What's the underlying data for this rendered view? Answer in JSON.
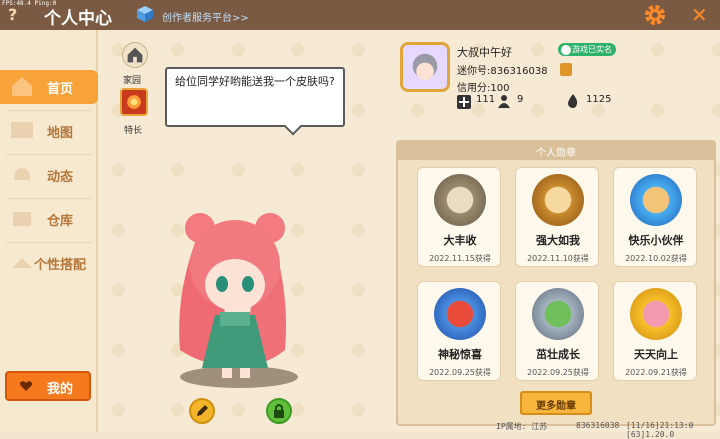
{
  "debug": {
    "fps_text": "FPS:48.4  Ping:0"
  },
  "header": {
    "title": "个人中心",
    "help_icon": "question-icon",
    "platform_link": "创作者服务平台>>",
    "accent": "#ff8a2a"
  },
  "sidebar": {
    "items": [
      {
        "label": "首页",
        "icon": "home-icon",
        "active": true
      },
      {
        "label": "地图",
        "icon": "map-icon",
        "active": false
      },
      {
        "label": "动态",
        "icon": "bell-icon",
        "active": false
      },
      {
        "label": "仓库",
        "icon": "box-icon",
        "active": false
      },
      {
        "label": "个性搭配",
        "icon": "hanger-icon",
        "active": false
      }
    ],
    "mine_button": "我的"
  },
  "home": {
    "home_label": "家园",
    "skill_label": "特长",
    "speech": "给位同学好哟能送我一个皮肤吗?"
  },
  "profile": {
    "username": "大叔中午好",
    "verified_badge": "游戏已实名",
    "mini_id": "迷你号:836316038",
    "credit": "信用分:100",
    "stats": [
      {
        "icon": "plus-icon",
        "value": "111"
      },
      {
        "icon": "people-icon",
        "value": "9"
      },
      {
        "icon": "flame-icon",
        "value": "1125"
      }
    ]
  },
  "medals": {
    "header": "个人勋章",
    "items": [
      {
        "name": "大丰收",
        "date": "2022.11.15获得",
        "color": "#c9b38a"
      },
      {
        "name": "强大如我",
        "date": "2022.11.10获得",
        "color": "#d8a44a"
      },
      {
        "name": "快乐小伙伴",
        "date": "2022.10.02获得",
        "color": "#3fa6e8"
      },
      {
        "name": "神秘惊喜",
        "date": "2022.09.25获得",
        "color": "#3a7fd8"
      },
      {
        "name": "茁壮成长",
        "date": "2022.09.25获得",
        "color": "#8a98a8"
      },
      {
        "name": "天天向上",
        "date": "2022.09.21获得",
        "color": "#f0b21e"
      }
    ],
    "more_button": "更多勋章"
  },
  "footer": {
    "location": "IP属地: 江苏",
    "id": "836316038",
    "time": "[11/16]21:13:0  [63]1.20.0"
  }
}
